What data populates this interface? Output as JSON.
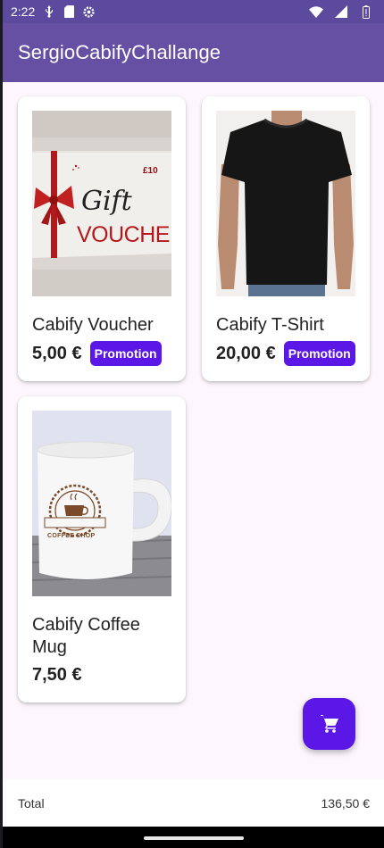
{
  "status_bar": {
    "time": "2:22",
    "icons_left": [
      "usb-icon",
      "sd-card-icon",
      "settings-icon"
    ],
    "icons_right": [
      "wifi-icon",
      "signal-icon",
      "battery-icon"
    ]
  },
  "app_bar": {
    "title": "SergioCabifyChallange"
  },
  "products": [
    {
      "name": "Cabify Voucher",
      "price": "5,00 €",
      "badge": "Promotion",
      "image": "gift-voucher-image",
      "voucher_texts": {
        "amount": "£10",
        "line1": "Gift",
        "line2": "VOUCHER"
      }
    },
    {
      "name": "Cabify T-Shirt",
      "price": "20,00 €",
      "badge": "Promotion",
      "image": "t-shirt-image"
    },
    {
      "name": "Cabify Coffee Mug",
      "price": "7,50 €",
      "badge": "",
      "image": "coffee-mug-image",
      "mug_text": "COFFEE SHOP"
    }
  ],
  "fab": {
    "icon": "shopping-cart-icon"
  },
  "footer": {
    "total_label": "Total",
    "total_value": "136,50 €"
  },
  "colors": {
    "app_bar": "#6650a4",
    "status_bar": "#5b4a9e",
    "accent": "#5b17e6",
    "background": "#fdf7fd"
  }
}
